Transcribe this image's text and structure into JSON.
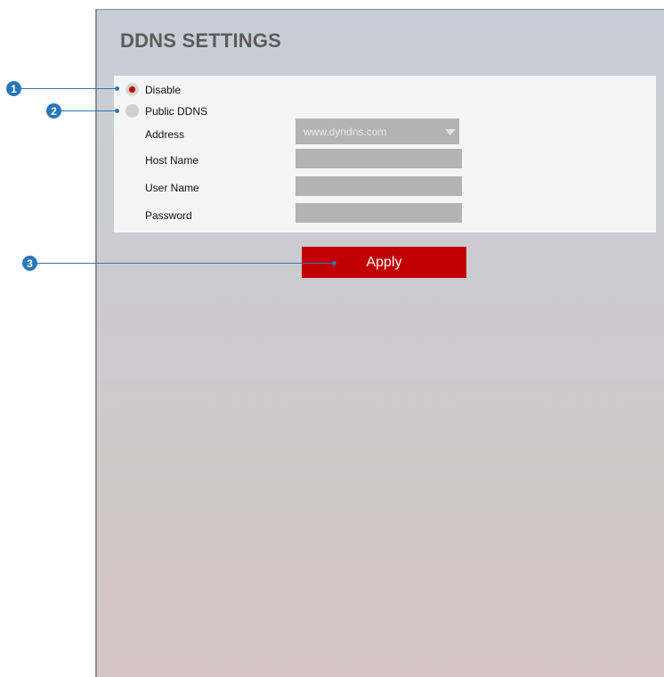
{
  "page": {
    "title": "DDNS SETTINGS"
  },
  "ddns": {
    "options": [
      {
        "label": "Disable",
        "selected": true
      },
      {
        "label": "Public DDNS",
        "selected": false
      }
    ],
    "fields": {
      "address": {
        "label": "Address",
        "value": "www.dyndns.com"
      },
      "host_name": {
        "label": "Host Name",
        "value": ""
      },
      "user_name": {
        "label": "User Name",
        "value": ""
      },
      "password": {
        "label": "Password",
        "value": ""
      }
    },
    "apply_label": "Apply"
  },
  "callouts": [
    "1",
    "2",
    "3"
  ],
  "colors": {
    "accent": "#c00000",
    "callout": "#2a77b7",
    "field": "#b3b3b3"
  }
}
